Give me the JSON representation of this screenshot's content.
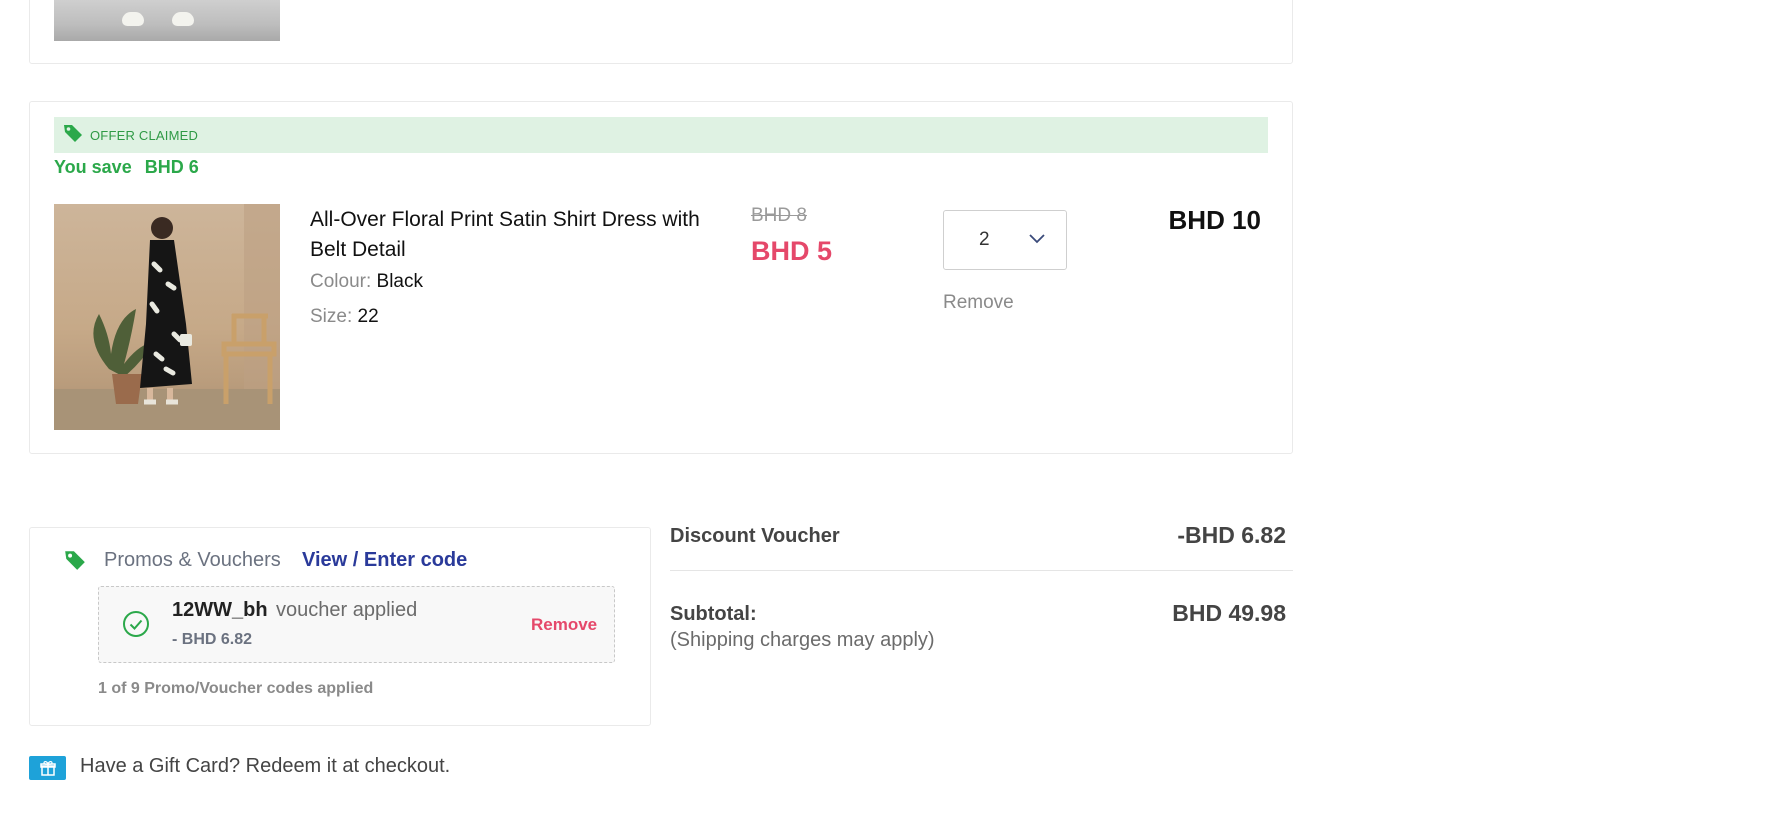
{
  "offer": {
    "badge": "OFFER CLAIMED",
    "save_label": "You save",
    "save_amount": "BHD 6",
    "icon": "tag-icon"
  },
  "item": {
    "title": "All-Over Floral Print Satin Shirt Dress with Belt Detail",
    "colour_label": "Colour:",
    "colour_value": "Black",
    "size_label": "Size:",
    "size_value": "22",
    "old_price": "BHD 8",
    "new_price": "BHD 5",
    "quantity": "2",
    "remove_label": "Remove",
    "line_total": "BHD 10"
  },
  "promos": {
    "label": "Promos & Vouchers",
    "link": "View / Enter code",
    "voucher_code": "12WW_bh",
    "voucher_status": "voucher applied",
    "voucher_amount": "- BHD 6.82",
    "remove_label": "Remove",
    "codes_applied": "1 of 9 Promo/Voucher codes applied"
  },
  "summary": {
    "discount_label": "Discount Voucher",
    "discount_value": "-BHD 6.82",
    "subtotal_label": "Subtotal:",
    "subtotal_value": "BHD 49.98",
    "shipping_note": "(Shipping charges may apply)"
  },
  "gift": {
    "text": "Have a Gift Card? Redeem it at checkout.",
    "icon": "gift-icon"
  },
  "colors": {
    "accent_green": "#2ba84a",
    "offer_bg": "#dff2e3",
    "price_red": "#e5486a",
    "link_blue": "#2a3a9a",
    "gift_blue": "#1ea2d9"
  }
}
